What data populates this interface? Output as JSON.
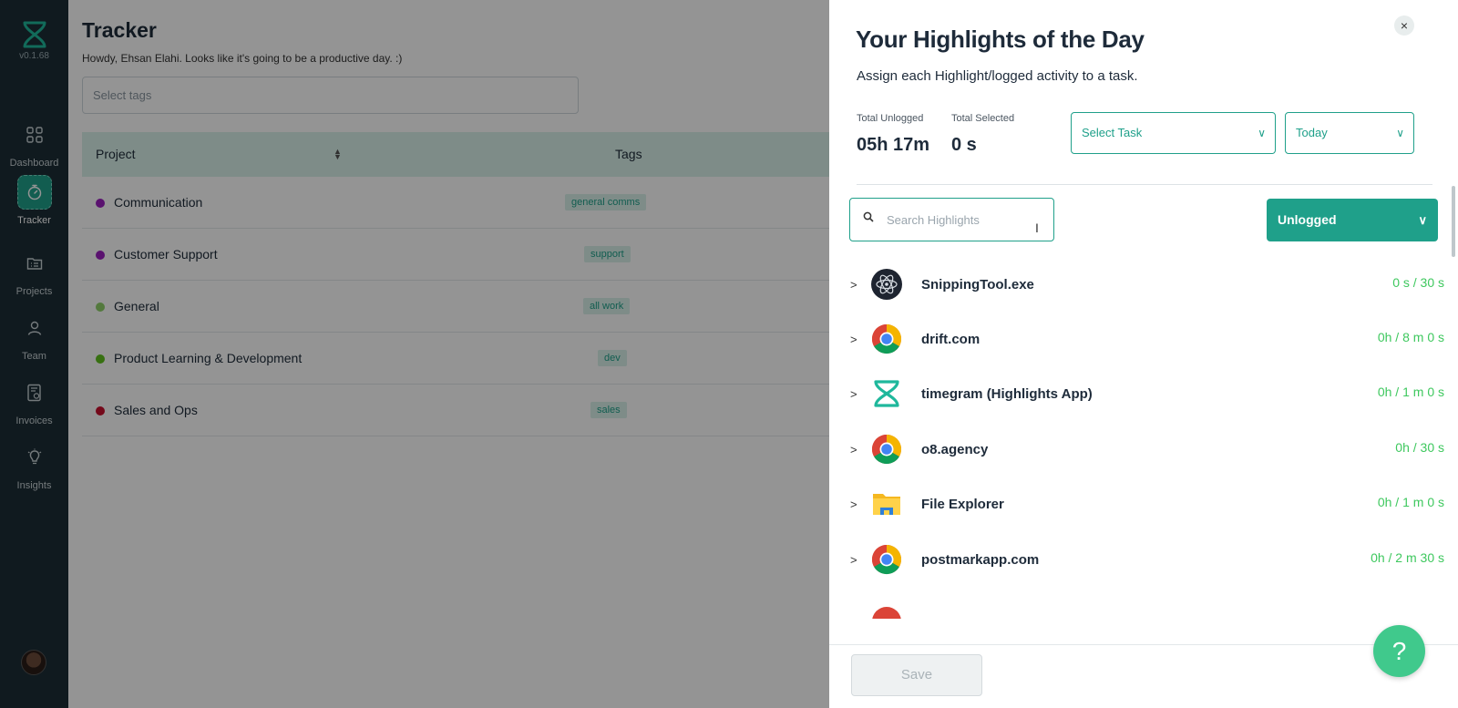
{
  "brand": {
    "version": "v0.1.68"
  },
  "sidebar": {
    "items": [
      {
        "label": "Dashboard",
        "icon": "grid-icon"
      },
      {
        "label": "Tracker",
        "icon": "stopwatch-icon",
        "active": true
      },
      {
        "label": "Projects",
        "icon": "folder-list-icon"
      },
      {
        "label": "Team",
        "icon": "person-icon"
      },
      {
        "label": "Invoices",
        "icon": "invoice-icon"
      },
      {
        "label": "Insights",
        "icon": "lightbulb-icon"
      }
    ]
  },
  "main": {
    "title": "Tracker",
    "greeting": "Howdy, Ehsan Elahi. Looks like it's going to be a productive day. :)",
    "tags_placeholder": "Select tags",
    "table": {
      "headers": {
        "project": "Project",
        "tags": "Tags"
      },
      "rows": [
        {
          "name": "Communication",
          "tag": "general comms",
          "color": "#9b1fbf"
        },
        {
          "name": "Customer Support",
          "tag": "support",
          "color": "#9b1fbf"
        },
        {
          "name": "General",
          "tag": "all work",
          "color": "#8fd16a"
        },
        {
          "name": "Product Learning & Development",
          "tag": "dev",
          "color": "#5fc21e"
        },
        {
          "name": "Sales and Ops",
          "tag": "sales",
          "color": "#c8102e"
        }
      ]
    }
  },
  "drawer": {
    "title": "Your Highlights of the Day",
    "subtitle": "Assign each Highlight/logged activity to a task.",
    "stats": {
      "unlogged_label": "Total Unlogged",
      "unlogged_value": "05h 17m",
      "selected_label": "Total Selected",
      "selected_value": "0 s"
    },
    "task_select": "Select Task",
    "date_select": "Today",
    "search_placeholder": "Search Highlights",
    "filter": "Unlogged",
    "items": [
      {
        "name": "SnippingTool.exe",
        "time": "0 s / 30 s",
        "icon": "atom-icon"
      },
      {
        "name": "drift.com",
        "time": "0h / 8 m 0 s",
        "icon": "chrome-icon"
      },
      {
        "name": "timegram (Highlights App)",
        "time": "0h / 1 m 0 s",
        "icon": "timegram-icon"
      },
      {
        "name": "o8.agency",
        "time": "0h / 30 s",
        "icon": "chrome-icon"
      },
      {
        "name": "File Explorer",
        "time": "0h / 1 m 0 s",
        "icon": "folder-icon"
      },
      {
        "name": "postmarkapp.com",
        "time": "0h / 2 m 30 s",
        "icon": "chrome-icon"
      }
    ],
    "save_label": "Save",
    "help_label": "?",
    "close_label": "×"
  },
  "colors": {
    "accent": "#1fa08a",
    "sidebar": "#1d2e36",
    "time_green": "#3ec85e"
  }
}
